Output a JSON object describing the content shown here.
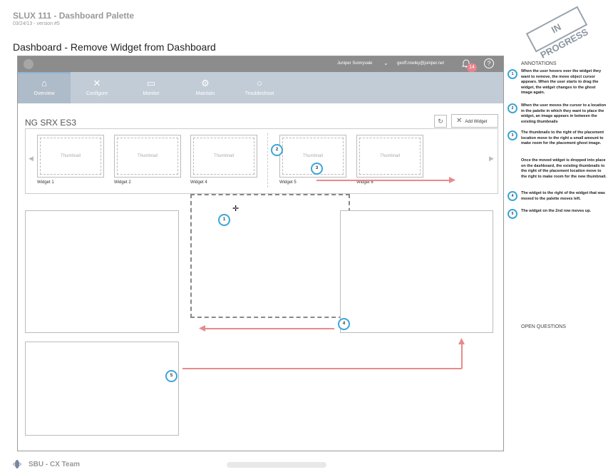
{
  "doc": {
    "title": "SLUX 111 - Dashboard Palette",
    "subtitle": "03/24/13 - version #5",
    "stamp": "IN PROGRESS",
    "heading": "Dashboard - Remove Widget from Dashboard"
  },
  "topbar": {
    "location": "Juniper Sunnyvale",
    "location_chevron": "⌄",
    "user_email": "geoff.rowley@juniper.net",
    "notification_count": "14",
    "help": "?"
  },
  "nav": {
    "items": [
      {
        "label": "Overview",
        "icon": "home-icon",
        "glyph": "⌂"
      },
      {
        "label": "Configure",
        "icon": "tools-icon",
        "glyph": "✕"
      },
      {
        "label": "Monitor",
        "icon": "monitor-icon",
        "glyph": "▭"
      },
      {
        "label": "Maintain",
        "icon": "gears-icon",
        "glyph": "⚙"
      },
      {
        "label": "Troubleshoot",
        "icon": "chat-icon",
        "glyph": "○"
      }
    ]
  },
  "workspace": {
    "title": "NG SRX ES3",
    "refresh_glyph": "↻",
    "add_widget_label": "Add Widget",
    "add_widget_glyph": "✕"
  },
  "palette": {
    "left_arrow": "◀",
    "right_arrow": "▶",
    "thumbnails": [
      {
        "placeholder": "Thumbnail",
        "label": "Widget 1"
      },
      {
        "placeholder": "Thumbnail",
        "label": "Widget 2"
      },
      {
        "placeholder": "Thumbnail",
        "label": "Widget 4"
      },
      {
        "placeholder": "Thumbnail",
        "label": "Widget 5"
      },
      {
        "placeholder": "Thumbnail",
        "label": "Widget 6"
      }
    ]
  },
  "cursor_glyph": "✛",
  "markers": [
    "1",
    "2",
    "3",
    "4",
    "5"
  ],
  "annotations": {
    "title": "ANNOTATIONS",
    "items": [
      {
        "num": "1",
        "text": "When the user hovers over the widget they want to remove, the move object cursor appears. When the user starts to drag the widget, the widget changes to the ghost image again."
      },
      {
        "num": "2",
        "text": "When the user moves the cursor to a location in the palette in which they want to place the widget, an image appears in between the existing thumbnails"
      },
      {
        "num": "3",
        "text": "The thumbnails to the right of the placement location move to the right a small amount to make room for the placement ghost image."
      },
      {
        "num": "",
        "text": "Once the moved widget is dropped into place on the dashboard, the existing thumbnails to the right of the placement location move to the right to make room for the new thumbnail."
      },
      {
        "num": "4",
        "text": "The widget to the right of the widget that was moved to the palette moves left."
      },
      {
        "num": "5",
        "text": "The widget on the 2nd row moves up."
      }
    ],
    "open_questions": "OPEN QUESTIONS"
  },
  "footer": {
    "team": "SBU - CX Team"
  },
  "colors": {
    "accent_marker": "#3ba6d6",
    "arrow": "#e88a8a",
    "nav_bg": "#c2ccd6",
    "topbar_bg": "#8c8c8c"
  }
}
